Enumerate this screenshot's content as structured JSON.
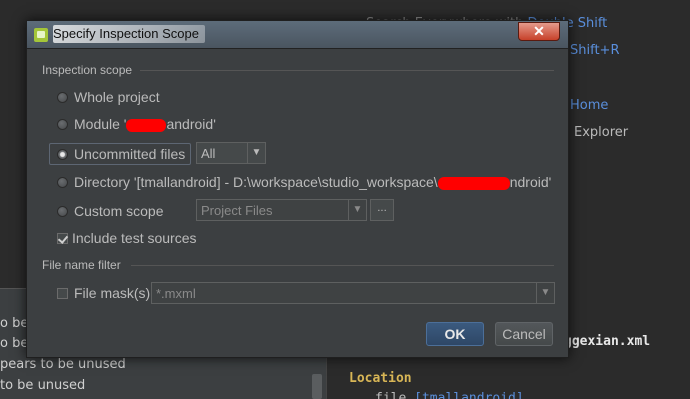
{
  "background": {
    "hints": [
      {
        "text": "Search Everywhere with ",
        "key": "Double Shift"
      },
      {
        "text": "",
        "key": "Shift+R"
      },
      {
        "text": "",
        "key": "Home"
      },
      {
        "text": "Explorer",
        "key": ""
      }
    ],
    "left_panel_lines": [
      "o be",
      "o be",
      "pears to be unused",
      "to be unused"
    ],
    "right_panel": {
      "file_name": "ggexian.xml",
      "location_label": "Location",
      "file_prefix": "file",
      "file_link": "[tmallandroid]"
    }
  },
  "dialog": {
    "title": "Specify Inspection Scope",
    "close_glyph": "✕",
    "inspection_scope_label": "Inspection scope",
    "options": {
      "whole_project": "Whole project",
      "module_prefix": "Module '",
      "module_suffix": "android'",
      "uncommitted": "Uncommitted files",
      "directory_prefix": "Directory '[tmallandroid] - D:\\workspace\\studio_workspace\\",
      "directory_suffix": "ndroid'",
      "custom_scope": "Custom scope"
    },
    "uncommitted_select": {
      "value": "All"
    },
    "custom_scope_select": {
      "value": "Project Files"
    },
    "custom_scope_more": "...",
    "include_test_sources": {
      "label": "Include test sources",
      "checked": true
    },
    "file_name_filter_label": "File name filter",
    "file_mask": {
      "label": "File mask(s)",
      "checked": false,
      "value": "*.mxml"
    },
    "ok_label": "OK",
    "cancel_label": "Cancel",
    "selected_option": "uncommitted",
    "colors": {
      "accent": "#5a8fdc",
      "redaction": "#ff0000",
      "ok_button": "#2e4766"
    }
  }
}
